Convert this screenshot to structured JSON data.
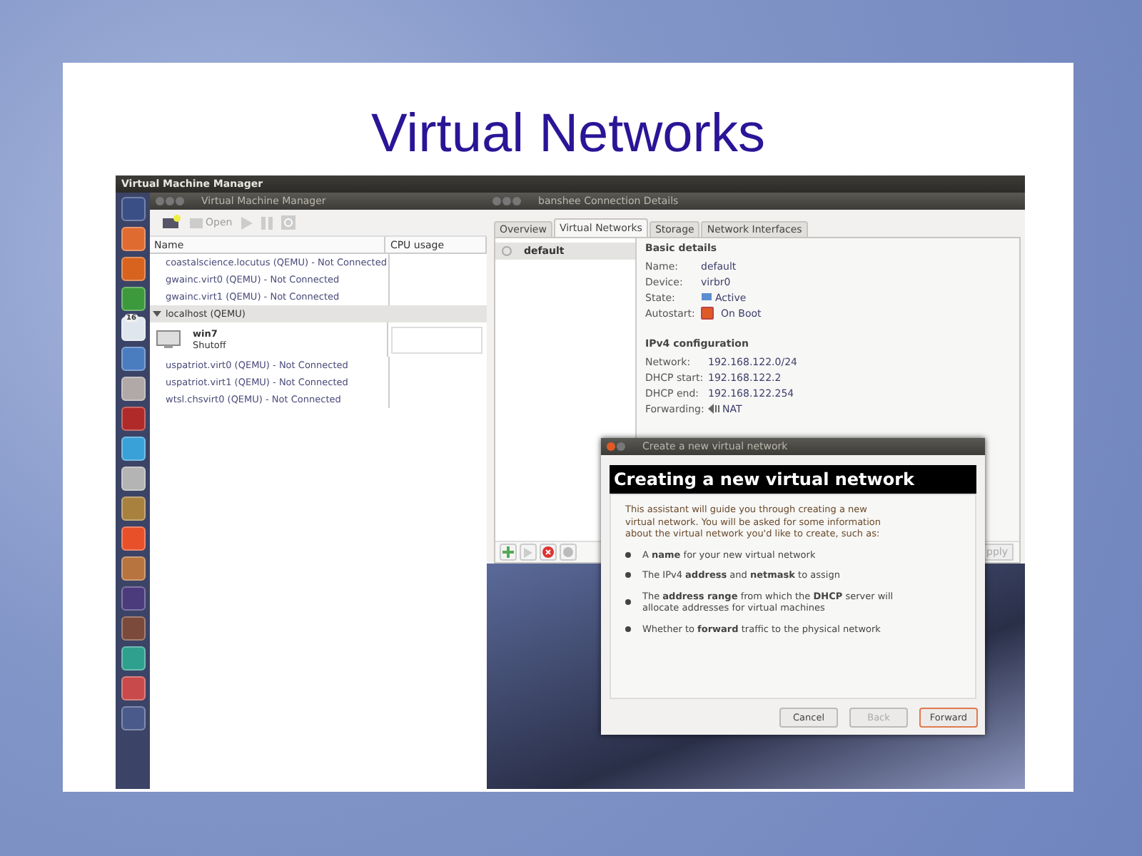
{
  "slide": {
    "title": "Virtual Networks"
  },
  "top_bar": {
    "title": "Virtual Machine Manager"
  },
  "launcher": [
    {
      "color": "#3a4f86"
    },
    {
      "color": "#e06b30"
    },
    {
      "color": "#d8631f"
    },
    {
      "color": "#3c9a3c"
    },
    {
      "color": "#dfe6ee",
      "badge": "16"
    },
    {
      "color": "#4a7cc0"
    },
    {
      "color": "#b0a9a8"
    },
    {
      "color": "#b02a2a"
    },
    {
      "color": "#3aa0d8"
    },
    {
      "color": "#b4b4b4"
    },
    {
      "color": "#a9813f"
    },
    {
      "color": "#e8502a"
    },
    {
      "color": "#b8743e"
    },
    {
      "color": "#4b3a7c"
    },
    {
      "color": "#7b4a3a"
    },
    {
      "color": "#2fa08e"
    },
    {
      "color": "#c94a4a"
    },
    {
      "color": "#4a5a8a"
    }
  ],
  "vmm": {
    "title": "Virtual Machine Manager",
    "toolbar": {
      "open": "Open"
    },
    "columns": [
      "Name",
      "CPU usage"
    ],
    "rows": [
      {
        "kind": "connection",
        "text": "coastalscience.locutus (QEMU) - Not Connected"
      },
      {
        "kind": "connection",
        "text": "gwainc.virt0 (QEMU) - Not Connected"
      },
      {
        "kind": "connection",
        "text": "gwainc.virt1 (QEMU) - Not Connected"
      },
      {
        "kind": "group",
        "text": "localhost (QEMU)",
        "expanded": true
      },
      {
        "kind": "vm",
        "text": "win7",
        "status": "Shutoff"
      },
      {
        "kind": "connection",
        "text": "uspatriot.virt0 (QEMU) - Not Connected"
      },
      {
        "kind": "connection",
        "text": "uspatriot.virt1 (QEMU) - Not Connected"
      },
      {
        "kind": "connection",
        "text": "wtsl.chsvirt0 (QEMU) - Not Connected"
      }
    ]
  },
  "details": {
    "title": "banshee Connection Details",
    "tabs": [
      {
        "label": "Overview",
        "selected": false
      },
      {
        "label": "Virtual Networks",
        "selected": true
      },
      {
        "label": "Storage",
        "selected": false
      },
      {
        "label": "Network Interfaces",
        "selected": false
      }
    ],
    "networks": [
      {
        "name": "default",
        "selected": true
      }
    ],
    "basic": {
      "heading": "Basic details",
      "fields": [
        {
          "label": "Name:",
          "value": "default",
          "kind": "text"
        },
        {
          "label": "Device:",
          "value": "virbr0",
          "kind": "text"
        },
        {
          "label": "State:",
          "value": "Active",
          "kind": "state"
        },
        {
          "label": "Autostart:",
          "value": "On Boot",
          "kind": "checkbox",
          "checked": true
        }
      ]
    },
    "ipv4": {
      "heading": "IPv4 configuration",
      "fields": [
        {
          "label": "Network:",
          "value": "192.168.122.0/24",
          "kind": "text"
        },
        {
          "label": "DHCP start:",
          "value": "192.168.122.2",
          "kind": "text"
        },
        {
          "label": "DHCP end:",
          "value": "192.168.122.254",
          "kind": "text"
        },
        {
          "label": "Forwarding:",
          "value": "NAT",
          "kind": "forward"
        }
      ]
    },
    "apply_button": "pply"
  },
  "dialog": {
    "title": "Create a new virtual network",
    "heading": "Creating a new virtual network",
    "intro": "This assistant will guide you through creating a new virtual network. You will be asked for some information about the virtual network you'd like to create, such as:",
    "bullets": [
      "A **name** for your new virtual network",
      "The IPv4 **address** and **netmask** to assign",
      "The **address range** from which the **DHCP** server will allocate addresses for virtual machines",
      "Whether to **forward** traffic to the physical network"
    ],
    "buttons": [
      {
        "label": "Cancel",
        "disabled": false,
        "default": false
      },
      {
        "label": "Back",
        "disabled": true,
        "default": false
      },
      {
        "label": "Forward",
        "disabled": false,
        "default": true
      }
    ]
  }
}
